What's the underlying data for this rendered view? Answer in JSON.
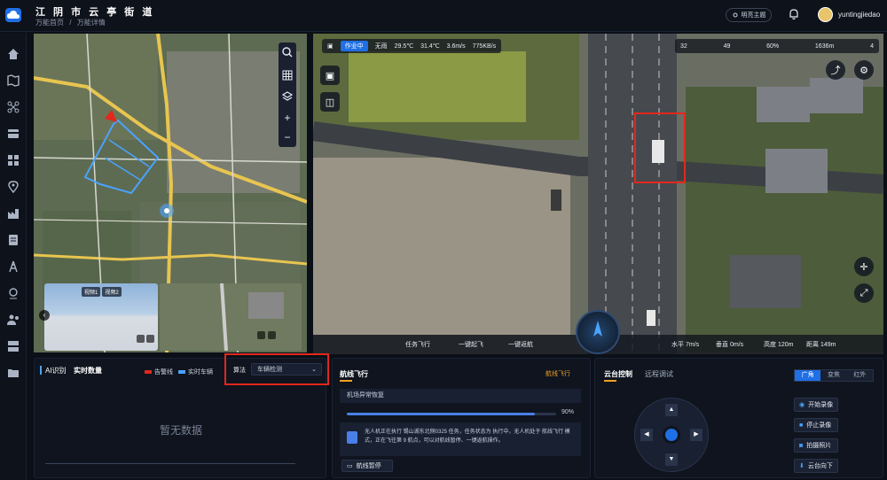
{
  "header": {
    "title": "江 阴 市 云 亭 街 道",
    "breadcrumb": [
      "万能首页",
      "/",
      "万能详情"
    ],
    "theme_button": "明亮主题",
    "username": "yuntingjiedao"
  },
  "map": {
    "video_tabs": [
      "视频1",
      "视频2"
    ],
    "tools": [
      "search-icon",
      "grid-icon",
      "layers-icon",
      "zoom-in-icon",
      "zoom-out-icon"
    ]
  },
  "drone_view": {
    "top_left": {
      "mode": "作业中",
      "weather": "无雨",
      "temp1": "29.5℃",
      "temp2": "31.4℃",
      "wind": "3.6m/s",
      "bandwidth": "775KB/s"
    },
    "top_right": {
      "v1": "32",
      "v2": "49",
      "v3": "60%",
      "v4": "1636m",
      "v5": "4"
    },
    "bottom_controls": [
      "任务飞行",
      "一键起飞",
      "一键返航"
    ],
    "telemetry": {
      "horizontal": "水平 7m/s",
      "vertical": "垂直 0m/s",
      "height": "高度 120m",
      "distance": "距离 149m"
    }
  },
  "ai_panel": {
    "tab_ai": "AI识别",
    "tab_realtime": "实时数量",
    "legend": [
      "告警线",
      "实时车辆"
    ],
    "algo_label": "算法",
    "algo_value": "车辆检测",
    "empty_text": "暂无数据"
  },
  "flight_panel": {
    "title": "航线飞行",
    "status": "航线飞行",
    "dock_status": "机场异常恢复",
    "progress_pct": 90,
    "progress_label": "90%",
    "message": "无人机正在执行 锡山湖东北侧0325 任务，任务状态为 执行中，无人机处于 航线飞行 模式，正在飞往第 9 航点，可以对航线暂停、一键返航操作。",
    "pause_button": "航线暂停"
  },
  "gimbal_panel": {
    "tab_control": "云台控制",
    "tab_remote": "远程调试",
    "lens_tabs": [
      "广角",
      "变焦",
      "红外"
    ],
    "actions": [
      "开始录像",
      "停止录像",
      "拍摄照片",
      "云台向下"
    ]
  }
}
